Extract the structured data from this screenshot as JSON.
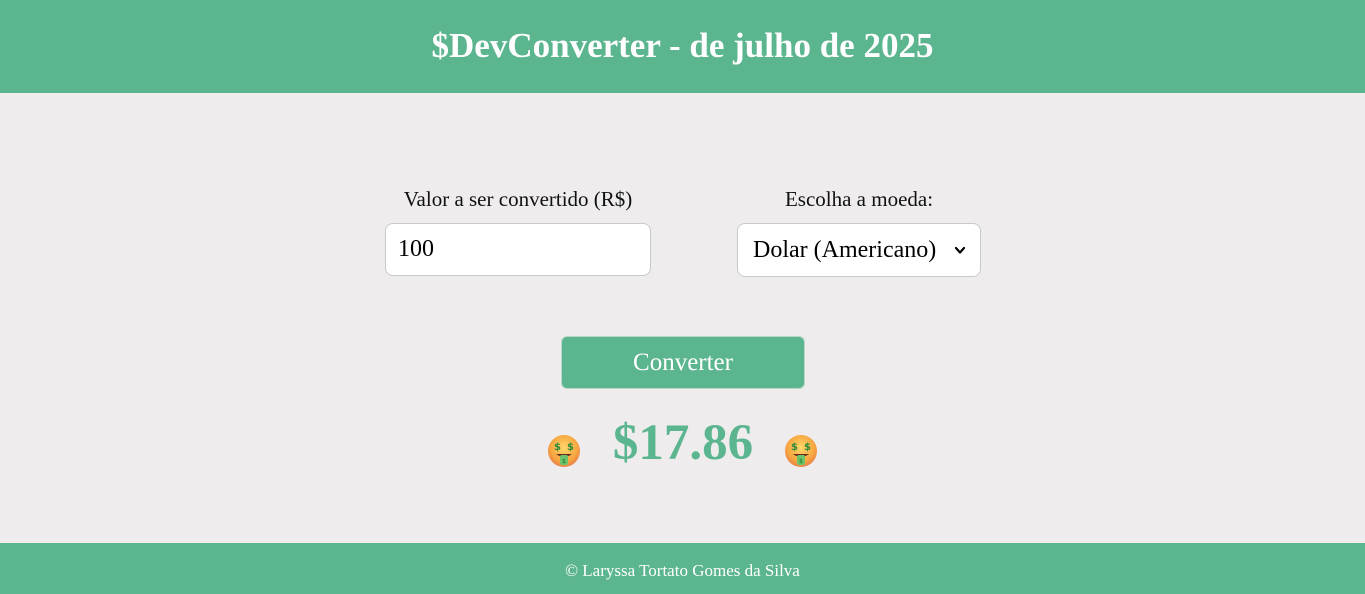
{
  "header": {
    "title": "$DevConverter - de julho de 2025"
  },
  "form": {
    "amount_label": "Valor a ser convertido (R$)",
    "amount_value": "100",
    "currency_label": "Escolha a moeda:",
    "currency_selected": "Dolar (Americano)",
    "convert_button_label": "Converter"
  },
  "result": {
    "value": "$17.86",
    "emoji_left": "money-mouth-face-icon",
    "emoji_right": "money-mouth-face-icon"
  },
  "footer": {
    "text": "© Laryssa Tortato Gomes da Silva"
  },
  "colors": {
    "brand_green": "#5bb58f",
    "background": "#eeeced",
    "text_white": "#ffffff"
  }
}
